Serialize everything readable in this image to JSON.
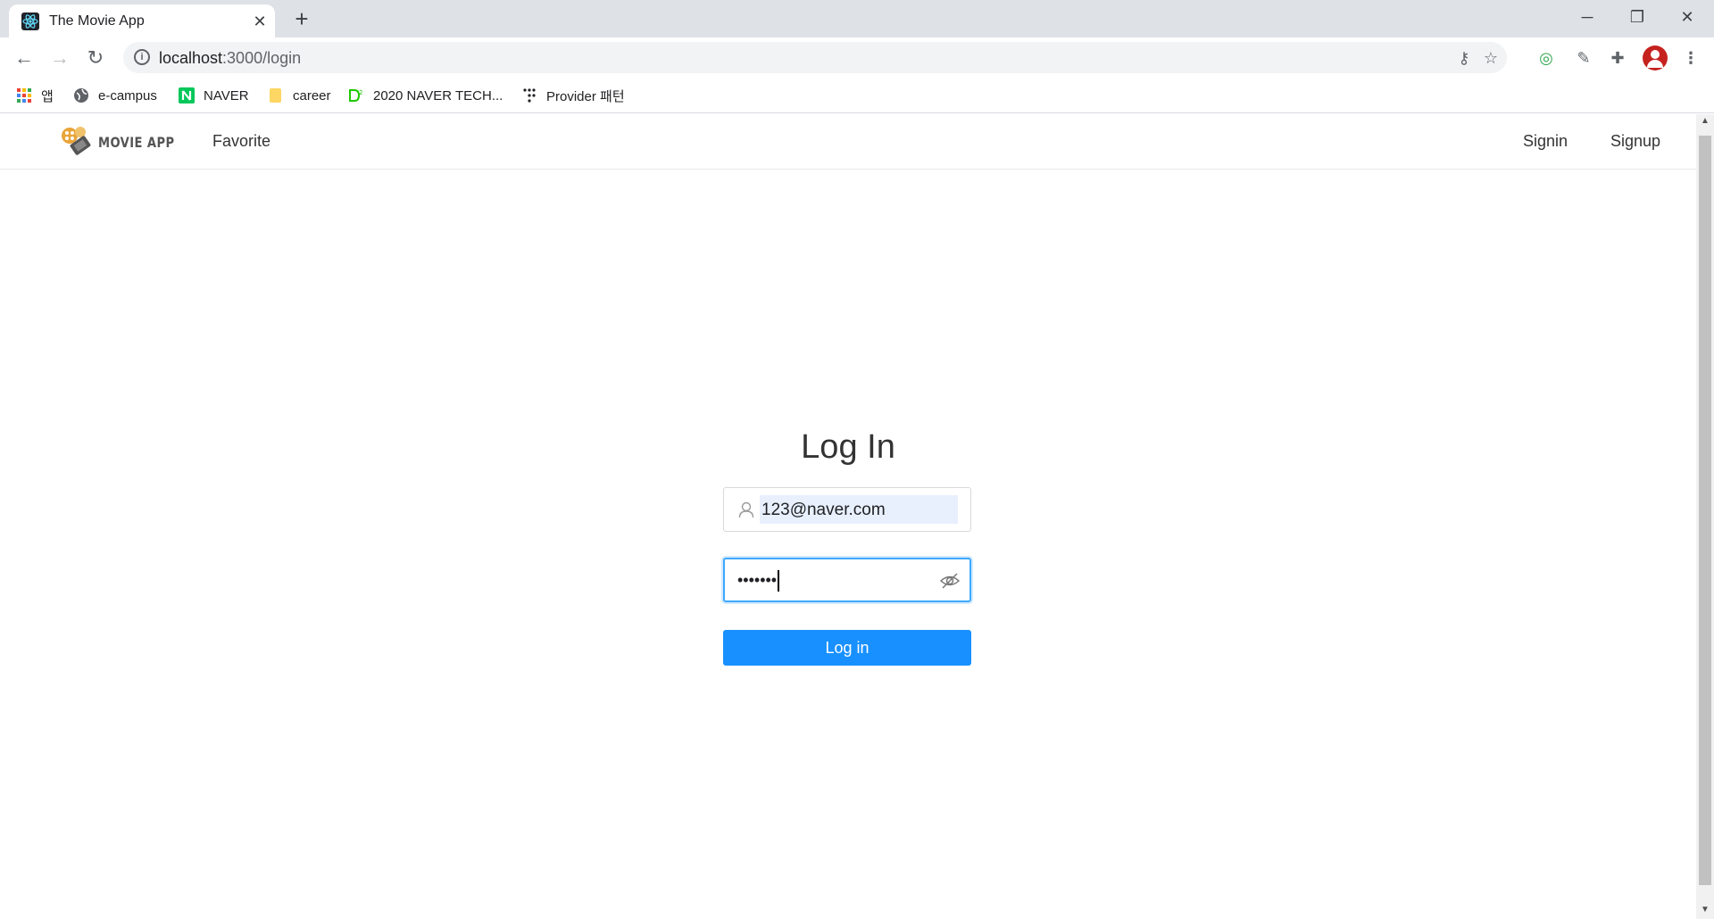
{
  "browser": {
    "tab_title": "The Movie App",
    "url_host": "localhost",
    "url_path": ":3000/login",
    "bookmarks": [
      {
        "label": "앱",
        "icon": "apps-grid-icon"
      },
      {
        "label": "e-campus",
        "icon": "globe-icon"
      },
      {
        "label": "NAVER",
        "icon": "naver-icon"
      },
      {
        "label": "career",
        "icon": "folder-icon"
      },
      {
        "label": "2020 NAVER TECH...",
        "icon": "d2-icon"
      },
      {
        "label": "Provider 패턴",
        "icon": "dots-icon"
      }
    ]
  },
  "app": {
    "logo_text": "MOVIE APP",
    "nav_left": [
      "Favorite"
    ],
    "nav_right": [
      "Signin",
      "Signup"
    ]
  },
  "login": {
    "title": "Log In",
    "email_value": "123@naver.com",
    "password_masked": "•••••••",
    "button_label": "Log in"
  },
  "colors": {
    "primary": "#1890ff",
    "autofill_bg": "#e8f0fe",
    "active_border": "#40a9ff"
  }
}
